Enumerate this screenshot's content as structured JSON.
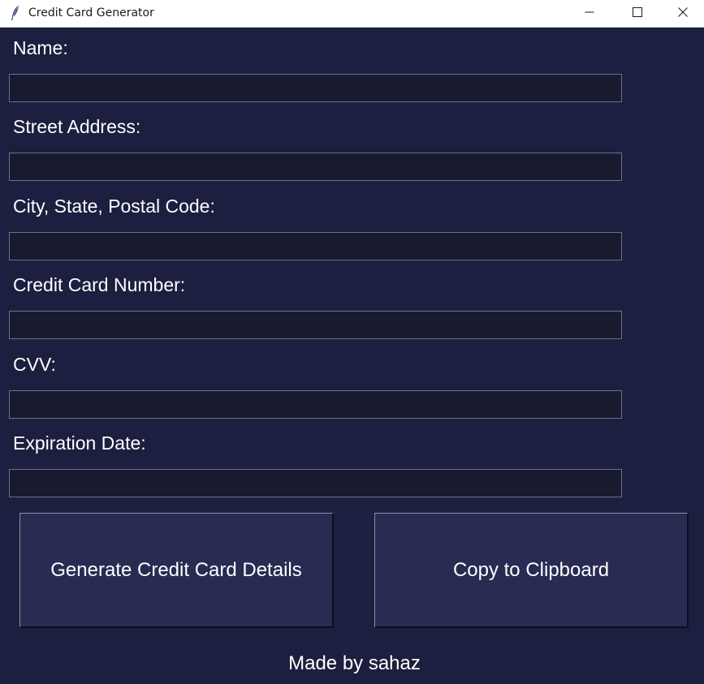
{
  "window": {
    "title": "Credit Card Generator",
    "icon": "feather-icon",
    "controls": [
      "minimize-icon",
      "maximize-icon",
      "close-icon"
    ]
  },
  "form": {
    "fields": [
      {
        "label": "Name:",
        "value": ""
      },
      {
        "label": "Street Address:",
        "value": ""
      },
      {
        "label": "City, State, Postal Code:",
        "value": ""
      },
      {
        "label": "Credit Card Number:",
        "value": ""
      },
      {
        "label": "CVV:",
        "value": ""
      },
      {
        "label": "Expiration Date:",
        "value": ""
      }
    ]
  },
  "buttons": {
    "generate_label": "Generate Credit Card Details",
    "copy_label": "Copy to Clipboard"
  },
  "footer": {
    "text": "Made by sahaz"
  },
  "colors": {
    "background": "#1c1f3f",
    "input_background": "#181a30",
    "button_background": "#282b52",
    "text": "#ffffff"
  }
}
